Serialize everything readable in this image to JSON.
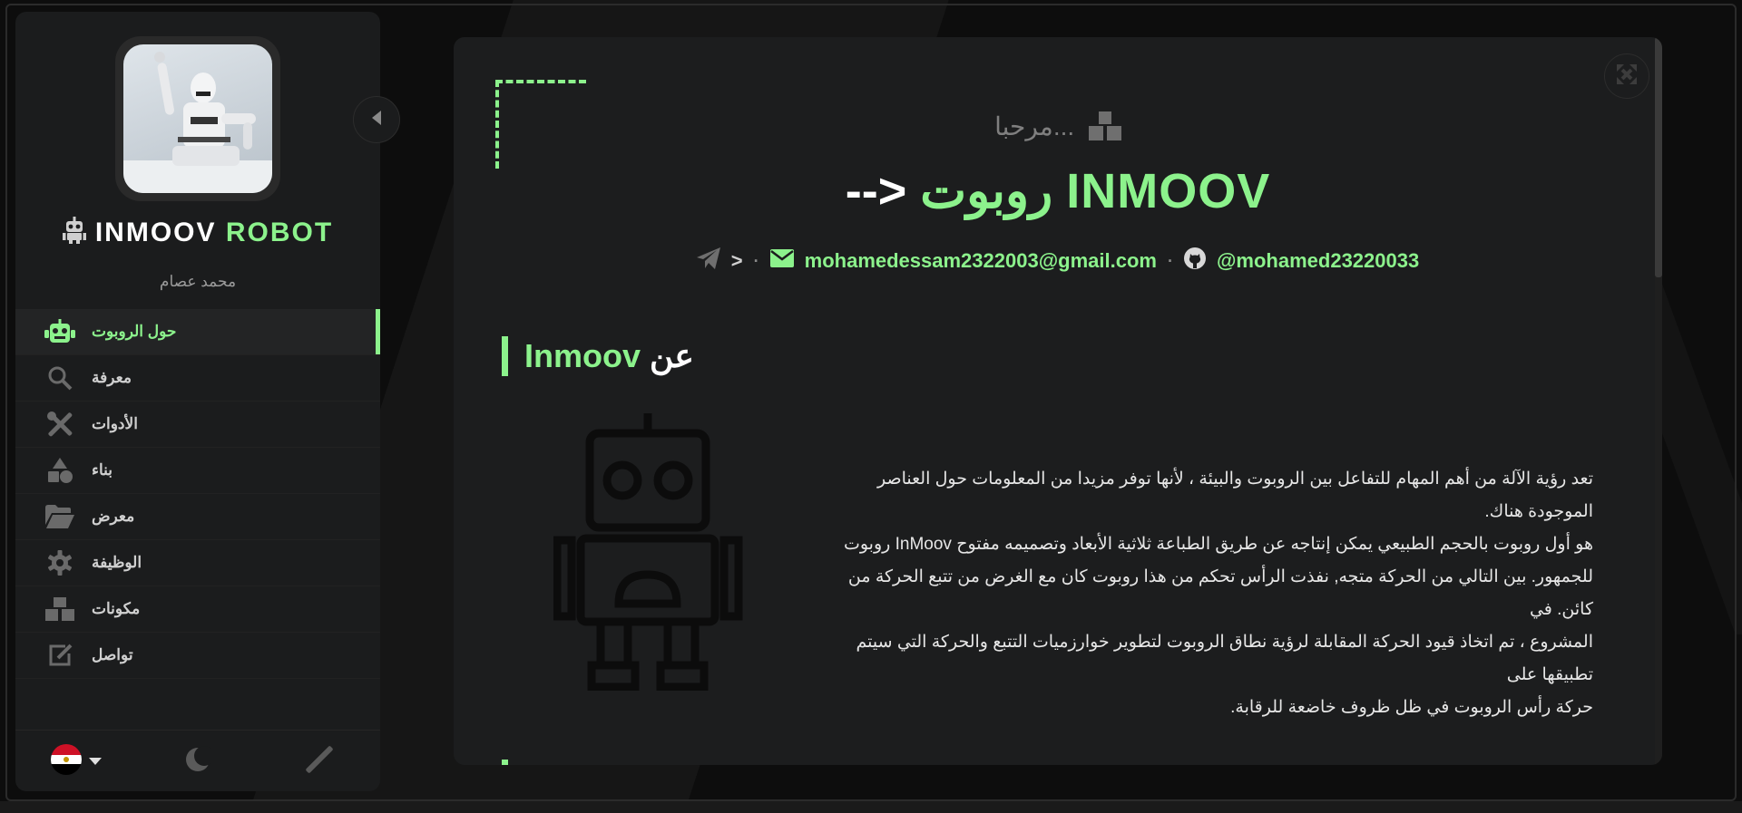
{
  "sidebar": {
    "brand_white": "INMOOV",
    "brand_green": "ROBOT",
    "subtitle": "محمد عصام",
    "items": [
      {
        "label": "حول الروبوت",
        "icon": "robot-icon",
        "active": true
      },
      {
        "label": "معرفة",
        "icon": "search-icon",
        "active": false
      },
      {
        "label": "الأدوات",
        "icon": "tools-icon",
        "active": false
      },
      {
        "label": "بناء",
        "icon": "shapes-icon",
        "active": false
      },
      {
        "label": "معرض",
        "icon": "folder-open-icon",
        "active": false
      },
      {
        "label": "الوظيفة",
        "icon": "gear-icon",
        "active": false
      },
      {
        "label": "مكونات",
        "icon": "cubes-icon",
        "active": false
      },
      {
        "label": "تواصل",
        "icon": "edit-icon",
        "active": false
      }
    ],
    "footer": {
      "language_icon": "egypt-flag-icon",
      "theme_icon": "moon-icon",
      "customize_icon": "pen-icon"
    }
  },
  "main": {
    "greeting": "مرحبا...",
    "headline_arrow": "-->",
    "headline_arabic": "روبوت",
    "headline_green": "INMOOV",
    "contact": {
      "telegram_text": ">",
      "email": "mohamedessam2322003@gmail.com",
      "github": "@mohamed23220033"
    },
    "section_title_green": "Inmoov",
    "section_title_white": "عن",
    "about_lines": [
      "تعد رؤية الآلة من أهم المهام للتفاعل بين الروبوت والبيئة ، لأنها توفر مزيدا من المعلومات حول العناصر الموجودة هناك.",
      "هو أول روبوت بالحجم الطبيعي يمكن إنتاجه عن طريق الطباعة ثلاثية الأبعاد وتصميمه مفتوح InMoov روبوت",
      "للجمهور. بين التالي من الحركة متجه, نفذت الرأس تحكم من هذا روبوت كان مع الغرض من تتبع الحركة من كائن. في",
      "المشروع ، تم اتخاذ قيود الحركة المقابلة لرؤية نطاق الروبوت لتطوير خوارزميات التتبع والحركة التي سيتم تطبيقها على",
      "حركة رأس الروبوت في ظل ظروف خاضعة للرقابة."
    ]
  },
  "colors": {
    "accent": "#8cf28c",
    "panel": "#1c1d1e",
    "sidebar": "#1b1c1d",
    "background": "#0d0d0d"
  }
}
